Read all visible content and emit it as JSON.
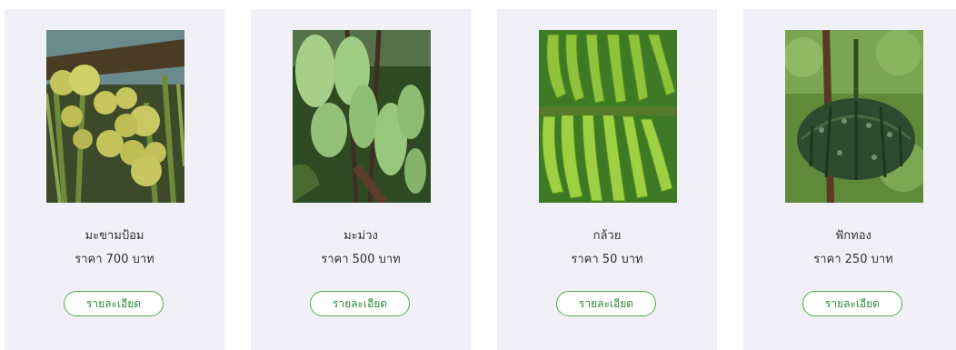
{
  "products": [
    {
      "name": "มะขามป้อม",
      "price": "ราคา 700 บาท",
      "button": "รายละเอียด",
      "image": "gooseberry-photo"
    },
    {
      "name": "มะม่วง",
      "price": "ราคา 500 บาท",
      "button": "รายละเอียด",
      "image": "mango-photo"
    },
    {
      "name": "กล้วย",
      "price": "ราคา 50 บาท",
      "button": "รายละเอียด",
      "image": "banana-photo"
    },
    {
      "name": "ฟักทอง",
      "price": "ราคา 250 บาท",
      "button": "รายละเอียด",
      "image": "pumpkin-photo"
    }
  ],
  "colors": {
    "card_bg": "#f1f0f6",
    "accent": "#4cae4f"
  }
}
